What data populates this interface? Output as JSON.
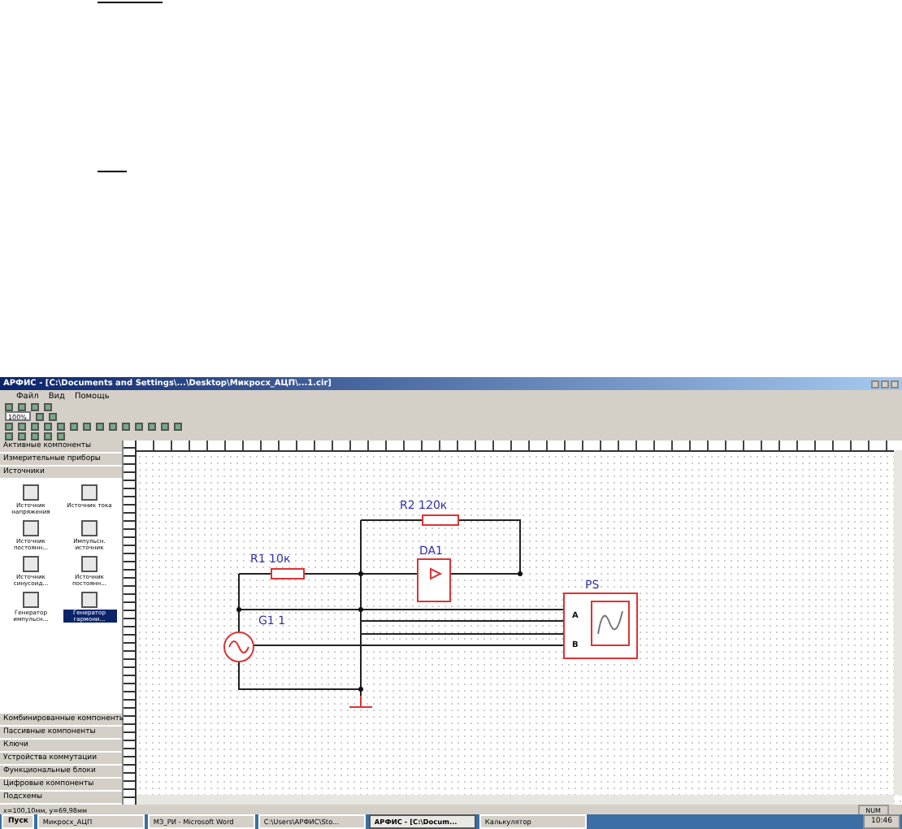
{
  "window": {
    "title": "АРФИС - [C:\\Documents and Settings\\...\\Desktop\\Микросх_АЦП\\...1.cir]"
  },
  "menu": [
    "Файл",
    "Вид",
    "Помощь"
  ],
  "zoom": {
    "value": "100%"
  },
  "sidebar": {
    "top_groups": [
      "Активные компоненты",
      "Измерительные приборы",
      "Источники"
    ],
    "items": [
      {
        "label": "Источник напряжения",
        "selected": false
      },
      {
        "label": "Источник тока",
        "selected": false
      },
      {
        "label": "Источник постоянн...",
        "selected": false
      },
      {
        "label": "Импульсн. источник",
        "selected": false
      },
      {
        "label": "Источник синусоид...",
        "selected": false
      },
      {
        "label": "Источник постоянн...",
        "selected": false
      },
      {
        "label": "Генератор импульсн...",
        "selected": false
      },
      {
        "label": "Генератор гармони...",
        "selected": true
      }
    ],
    "bottom_groups": [
      "Комбинированные компоненты",
      "Пассивные компоненты",
      "Ключи",
      "Устройства коммутации",
      "Функциональные блоки",
      "Цифровые компоненты",
      "Подсхемы"
    ]
  },
  "circuit": {
    "r1": "R1 10к",
    "r2": "R2 120к",
    "opamp": "DA1",
    "generator": "G1 1",
    "scope": "PS",
    "input_a": "A",
    "input_b": "B"
  },
  "status_bar": {
    "coords": "x=100,10мм, y=69,98мм",
    "mode": "NUM"
  },
  "taskbar": {
    "start": "Пуск",
    "buttons": [
      {
        "label": "Микросх_АЦП",
        "selected": false
      },
      {
        "label": "МЗ_РИ - Microsoft Word",
        "selected": false
      },
      {
        "label": "C:\\Users\\АРФИС\\Sto...",
        "selected": false
      },
      {
        "label": "АРФИС - [C:\\Docum...",
        "selected": true
      },
      {
        "label": "Калькулятор",
        "selected": false
      }
    ],
    "clock": "10:46"
  }
}
